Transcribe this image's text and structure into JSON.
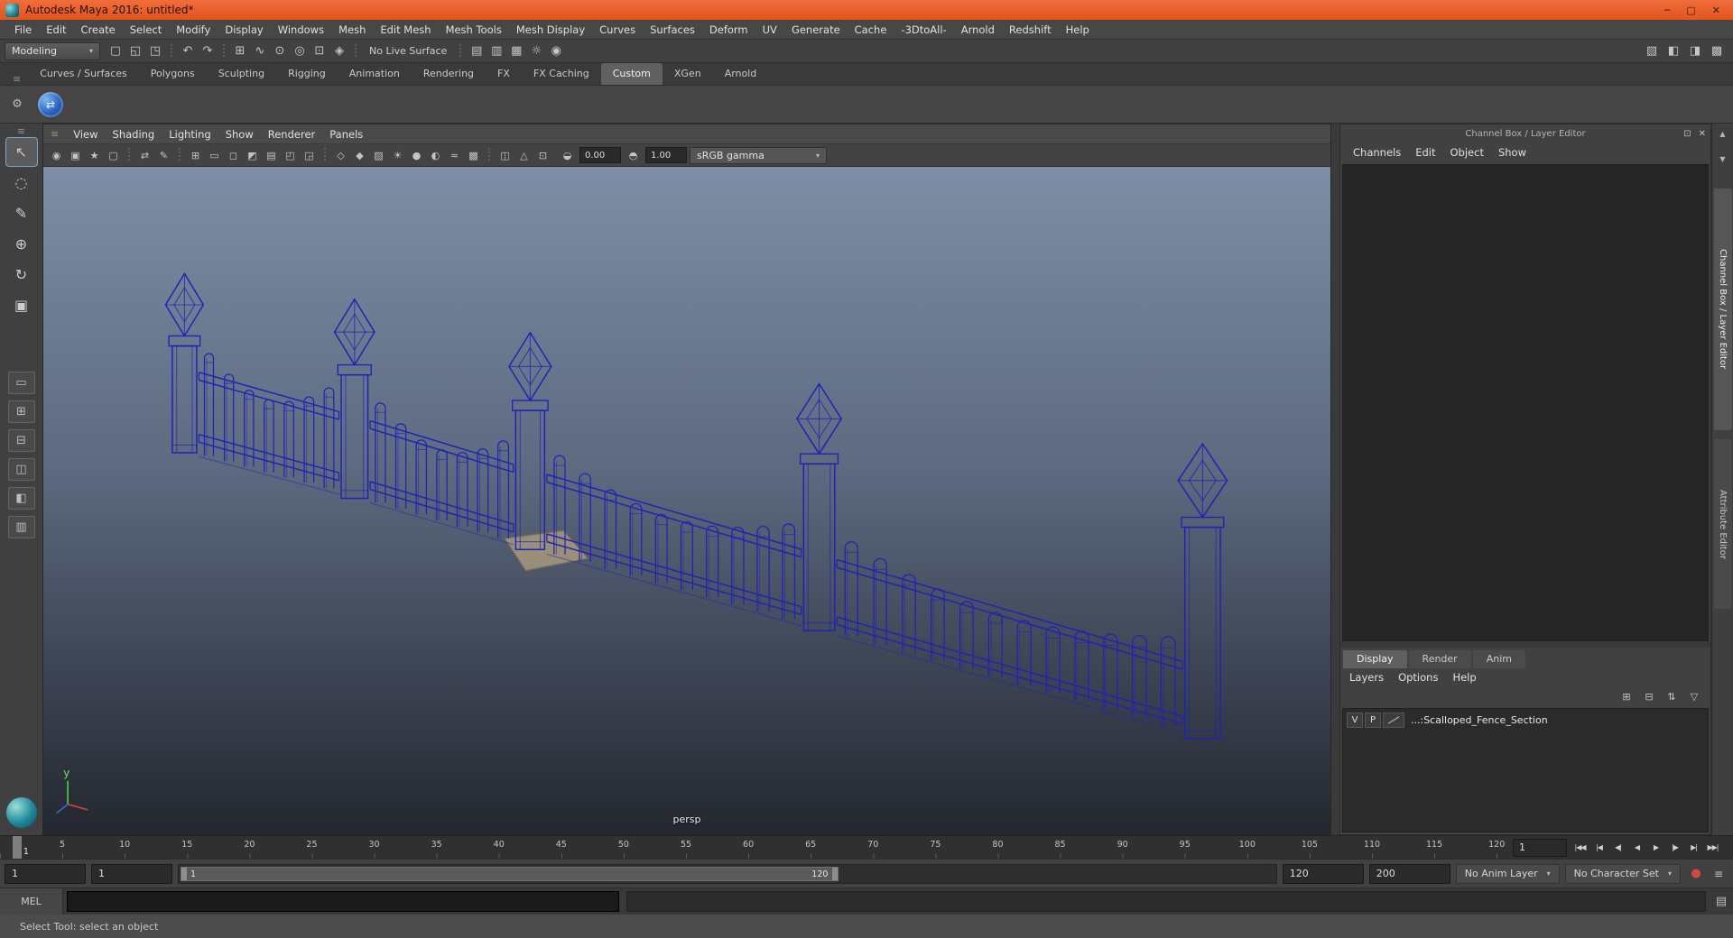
{
  "colors": {
    "titlebar": "#e2541d",
    "wireframe": "#2222b2",
    "viewport_top": "#7e8ea6",
    "viewport_bottom": "#23272e",
    "active_tool_outline": "#7ba7c7"
  },
  "window": {
    "title": "Autodesk Maya 2016: untitled*",
    "controls": [
      [
        "minimize-button",
        "─"
      ],
      [
        "maximize-button",
        "▢"
      ],
      [
        "close-button",
        "✕"
      ]
    ]
  },
  "menubar": {
    "items": [
      "File",
      "Edit",
      "Create",
      "Select",
      "Modify",
      "Display",
      "Windows",
      "Mesh",
      "Edit Mesh",
      "Mesh Tools",
      "Mesh Display",
      "Curves",
      "Surfaces",
      "Deform",
      "UV",
      "Generate",
      "Cache",
      "-3DtoAll-",
      "Arnold",
      "Redshift",
      "Help"
    ]
  },
  "statusline": {
    "menuset": "Modeling",
    "groups": [
      {
        "icons": [
          [
            "new-scene-icon",
            "▢"
          ],
          [
            "open-scene-icon",
            "◱"
          ],
          [
            "save-scene-icon",
            "◳"
          ]
        ]
      },
      {
        "icons": [
          [
            "undo-icon",
            "↶"
          ],
          [
            "redo-icon",
            "↷"
          ]
        ]
      },
      {
        "icons": [
          [
            "snap-to-grid-icon",
            "⊞"
          ],
          [
            "snap-to-curve-icon",
            "∿"
          ],
          [
            "snap-to-point-icon",
            "⊙"
          ],
          [
            "snap-to-projected-center-icon",
            "◎"
          ],
          [
            "snap-to-view-plane-icon",
            "⊡"
          ],
          [
            "make-live-icon",
            "◈"
          ]
        ]
      },
      {
        "label": "No Live Surface"
      },
      {
        "icons": [
          [
            "render-current-frame-icon",
            "▤"
          ],
          [
            "ipr-render-icon",
            "▥"
          ],
          [
            "render-sequence-icon",
            "▦"
          ],
          [
            "render-settings-icon",
            "☼"
          ],
          [
            "hypershade-icon",
            "◉"
          ]
        ]
      }
    ],
    "right_icons": [
      [
        "toggle-ui-elements-icon",
        "▧"
      ],
      [
        "toggle-tool-settings-icon",
        "◧"
      ],
      [
        "toggle-attribute-editor-icon",
        "◨"
      ],
      [
        "toggle-channel-box-icon",
        "▩"
      ]
    ]
  },
  "shelf": {
    "tabs": [
      "Curves / Surfaces",
      "Polygons",
      "Sculpting",
      "Rigging",
      "Animation",
      "Rendering",
      "FX",
      "FX Caching",
      "Custom",
      "XGen",
      "Arnold"
    ],
    "active_tab": "Custom"
  },
  "toolbox": {
    "tools": [
      [
        "select-tool-icon",
        "↖"
      ],
      [
        "lasso-tool-icon",
        "◌"
      ],
      [
        "paint-select-tool-icon",
        "✎"
      ],
      [
        "move-tool-icon",
        "⊕"
      ],
      [
        "rotate-tool-icon",
        "↻"
      ],
      [
        "scale-tool-icon",
        "▣"
      ]
    ],
    "active_tool": "select-tool-icon",
    "layouts": [
      [
        "single-pane-layout-icon",
        "▭"
      ],
      [
        "four-pane-layout-icon",
        "⊞"
      ],
      [
        "two-pane-stacked-layout-icon",
        "⊟"
      ],
      [
        "two-pane-side-layout-icon",
        "◫"
      ],
      [
        "three-pane-split-layout-icon",
        "◧"
      ],
      [
        "outliner-persp-layout-icon",
        "▥"
      ]
    ]
  },
  "viewport": {
    "menus": [
      "View",
      "Shading",
      "Lighting",
      "Show",
      "Renderer",
      "Panels"
    ],
    "toolbar_groups": [
      [
        [
          "select-camera-icon",
          "◉"
        ],
        [
          "camera-attributes-icon",
          "▣"
        ],
        [
          "bookmarks-icon",
          "★"
        ],
        [
          "image-plane-icon",
          "▢"
        ]
      ],
      [
        [
          "two-d-pan-zoom-icon",
          "⇄"
        ],
        [
          "grease-pencil-icon",
          "✎"
        ]
      ],
      [
        [
          "grid-icon",
          "⊞"
        ],
        [
          "film-gate-icon",
          "▭"
        ],
        [
          "resolution-gate-icon",
          "◻"
        ],
        [
          "gate-mask-icon",
          "◩"
        ],
        [
          "field-chart-icon",
          "▤"
        ],
        [
          "safe-action-icon",
          "◰"
        ],
        [
          "safe-title-icon",
          "◲"
        ]
      ],
      [
        [
          "wireframe-icon",
          "◇"
        ],
        [
          "shaded-icon",
          "◆"
        ],
        [
          "textured-icon",
          "▨"
        ],
        [
          "use-all-lights-icon",
          "☀"
        ],
        [
          "shadows-icon",
          "●"
        ],
        [
          "screen-space-ao-icon",
          "◐"
        ],
        [
          "motion-blur-icon",
          "≈"
        ],
        [
          "anti-alias-icon",
          "▩"
        ]
      ],
      [
        [
          "xray-icon",
          "◫"
        ],
        [
          "xray-joints-icon",
          "△"
        ],
        [
          "isolate-select-icon",
          "⊡"
        ]
      ]
    ],
    "extra_icons": [
      [
        "exposure-icon",
        "◒"
      ],
      [
        "gamma-icon",
        "◓"
      ]
    ],
    "exposure_label": "0.00",
    "gamma_label": "1.00",
    "view_transform": "sRGB gamma",
    "camera_label": "persp"
  },
  "channel_box": {
    "header_title": "Channel Box / Layer Editor",
    "header_icons": [
      [
        "dock-panel-icon",
        "⊡"
      ],
      [
        "close-panel-icon",
        "✕"
      ]
    ],
    "menus": [
      "Channels",
      "Edit",
      "Object",
      "Show"
    ],
    "layer_editor": {
      "tabs": [
        "Display",
        "Render",
        "Anim"
      ],
      "active_tab": "Display",
      "menus": [
        "Layers",
        "Options",
        "Help"
      ],
      "toolbar_icons": [
        [
          "create-empty-layer-icon",
          "⊞"
        ],
        [
          "create-layer-from-selected-icon",
          "⊟"
        ],
        [
          "sort-layers-icon",
          "⇅"
        ],
        [
          "layer-filter-icon",
          "▽"
        ]
      ],
      "layer_row": {
        "visibility": "V",
        "playback": "P",
        "name": "...:Scalloped_Fence_Section"
      }
    }
  },
  "side_strip": {
    "scroll_icons": [
      [
        "strip-scroll-up-icon",
        "▲"
      ],
      [
        "strip-scroll-down-icon",
        "▼"
      ]
    ],
    "tabs": [
      "Channel Box / Layer Editor",
      "Attribute Editor"
    ],
    "active_tab": "Channel Box / Layer Editor"
  },
  "timeline": {
    "tick_frames": [
      5,
      10,
      15,
      20,
      25,
      30,
      35,
      40,
      45,
      50,
      55,
      60,
      65,
      70,
      75,
      80,
      85,
      90,
      95,
      100,
      105,
      110,
      115,
      120
    ],
    "visible_range_end": 121,
    "current_frame": 1,
    "frame_field": "1",
    "transport": [
      [
        "go-to-start-button",
        "|◀◀"
      ],
      [
        "step-back-frame-button",
        "|◀"
      ],
      [
        "step-back-key-button",
        "◀|"
      ],
      [
        "play-backwards-button",
        "◀"
      ],
      [
        "play-forwards-button",
        "▶"
      ],
      [
        "step-forward-key-button",
        "|▶"
      ],
      [
        "step-forward-frame-button",
        "▶|"
      ],
      [
        "go-to-end-button",
        "▶▶|"
      ]
    ]
  },
  "range_slider": {
    "anim_start": "1",
    "playback_start": "1",
    "range_start_label": "1",
    "range_end_label": "120",
    "playback_end": "120",
    "anim_end": "200",
    "anim_layer": "No Anim Layer",
    "character_set": "No Character Set",
    "icons": [
      [
        "auto-keyframe-icon",
        "●"
      ],
      [
        "animation-preferences-icon",
        "≡"
      ]
    ]
  },
  "command_line": {
    "mel_label": "MEL",
    "input_value": "",
    "result_value": "",
    "script_editor_icon": [
      "script-editor-icon",
      "▤"
    ]
  },
  "help_line": {
    "text": "Select Tool: select an object"
  }
}
